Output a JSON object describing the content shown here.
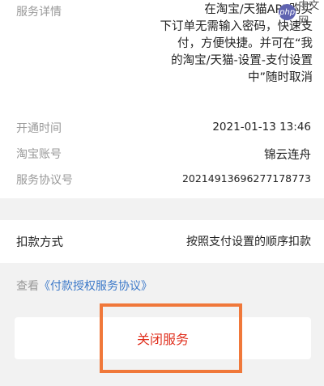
{
  "service_details": {
    "label": "服务详情",
    "lines": [
      "在淘宝/天猫APP购买",
      "下订单无需输入密码，快速支",
      "付，方便快捷。并可在“我",
      "的淘宝/天猫-设置-支付设置",
      "中”随时取消"
    ]
  },
  "info": {
    "open_time_label": "开通时间",
    "open_time_value": "2021-01-13 13:46",
    "account_label": "淘宝账号",
    "account_value": "锦云连舟",
    "agreement_no_label": "服务协议号",
    "agreement_no_value": "20214913696277178773"
  },
  "payment": {
    "label": "扣款方式",
    "value": "按照支付设置的顺序扣款"
  },
  "agreement_link": {
    "prefix": "查看",
    "link_text": "《付款授权服务协议》"
  },
  "close_button": {
    "label": "关闭服务",
    "color": "#e0301e"
  },
  "highlight_color": "#f0783a",
  "watermark": {
    "badge": "php",
    "text": "中文网"
  }
}
